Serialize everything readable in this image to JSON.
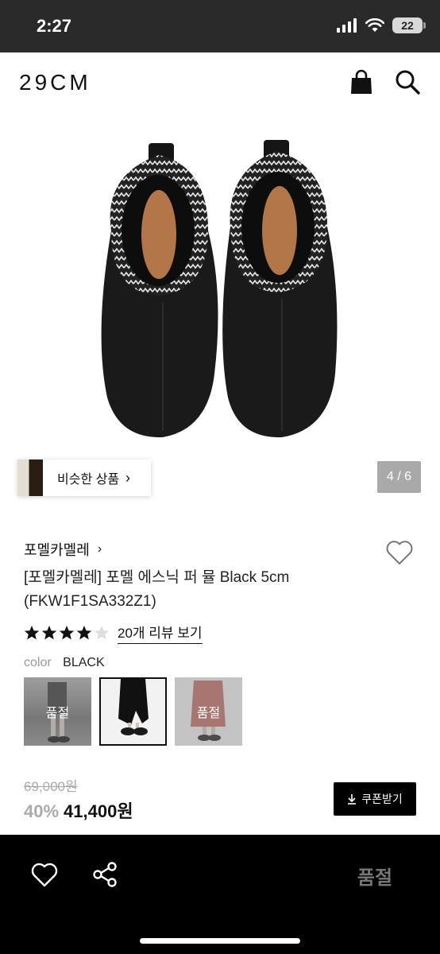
{
  "status_bar": {
    "time": "2:27",
    "battery": "22"
  },
  "header": {
    "logo": "29CM",
    "icons": [
      "shopping-bag-icon",
      "search-icon"
    ]
  },
  "gallery": {
    "similar_products_label": "비슷한 상품",
    "page_counter": "4 / 6"
  },
  "product": {
    "brand": "포멜카멜레",
    "title": "[포멜카멜레] 포멜 에스닉 퍼 뮬 Black 5cm (FKW1F1SA332Z1)",
    "rating": 4,
    "rating_max": 5,
    "review_link": "20개 리뷰 보기",
    "color_label": "color",
    "color_value": "BLACK",
    "swatches": [
      {
        "status": "품절",
        "selected": false
      },
      {
        "status": "",
        "selected": true
      },
      {
        "status": "품절",
        "selected": false
      }
    ],
    "original_price": "69,000원",
    "discount": "40%",
    "sale_price": "41,400원",
    "coupon_button": "쿠폰받기"
  },
  "bottom_bar": {
    "sold_out_label": "품절",
    "icons": [
      "heart-icon",
      "share-icon"
    ]
  },
  "colors": {
    "accent": "#000000",
    "muted": "#aaaaaa",
    "status_bar_bg": "#2a2a2a"
  }
}
